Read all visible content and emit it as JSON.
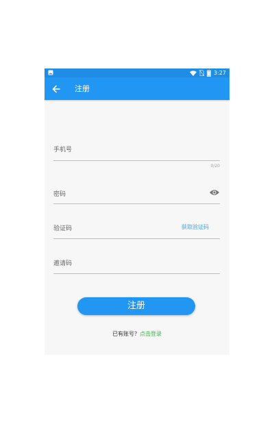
{
  "status_bar": {
    "time": "3:27",
    "icons": [
      "image-icon",
      "wifi-icon",
      "no-sim-icon",
      "battery-icon"
    ]
  },
  "app_bar": {
    "title": "注册",
    "back_icon": "arrow-left-icon"
  },
  "form": {
    "phone": {
      "placeholder": "手机号",
      "value": "",
      "counter": "0/20"
    },
    "password": {
      "placeholder": "密码",
      "value": "",
      "toggle_icon": "eye-icon"
    },
    "verify_code": {
      "placeholder": "验证码",
      "value": "",
      "get_code_label": "获取验证码"
    },
    "invite_code": {
      "placeholder": "邀请码",
      "value": ""
    }
  },
  "submit_label": "注册",
  "login_prompt": {
    "text": "已有账号？",
    "link": "点击登录"
  },
  "colors": {
    "primary": "#2196f3",
    "status_bar": "#1f8de6",
    "link_green": "#4caf50",
    "code_link": "#4fa3e0"
  }
}
